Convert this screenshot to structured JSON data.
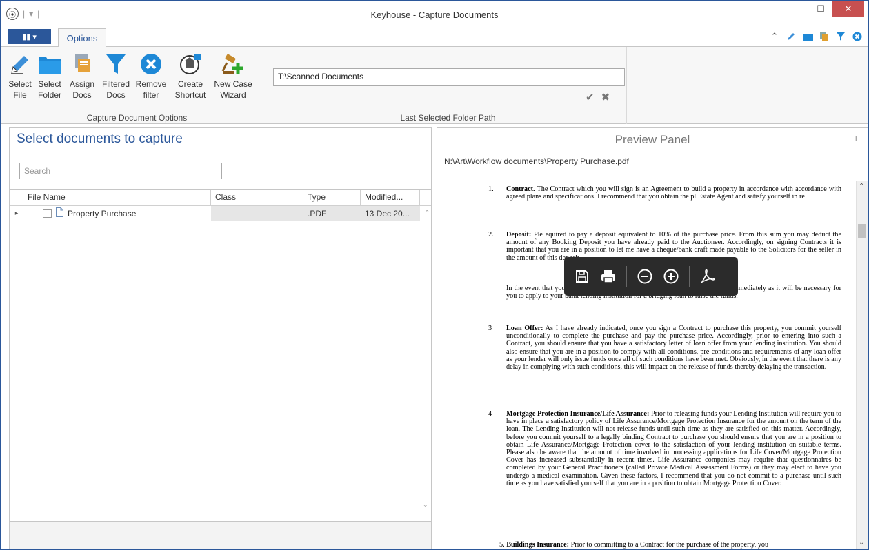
{
  "window": {
    "title": "Keyhouse - Capture Documents"
  },
  "tabs": {
    "file_label": "▮▮ ▾",
    "options_label": "Options"
  },
  "ribbon": {
    "capture_group_label": "Capture Document Options",
    "buttons": [
      {
        "line1": "Select",
        "line2": "File",
        "icon": "pencil-icon"
      },
      {
        "line1": "Select",
        "line2": "Folder",
        "icon": "folder-icon"
      },
      {
        "line1": "Assign",
        "line2": "Docs",
        "icon": "assign-docs-icon"
      },
      {
        "line1": "Filtered",
        "line2": "Docs",
        "icon": "filter-icon"
      },
      {
        "line1": "Remove",
        "line2": "filter",
        "icon": "remove-filter-icon"
      },
      {
        "line1": "Create",
        "line2": "Shortcut",
        "icon": "shortcut-icon"
      },
      {
        "line1": "New Case",
        "line2": "Wizard",
        "icon": "wizard-icon"
      }
    ],
    "folder_group_label": "Last Selected Folder Path",
    "folder_path": "T:\\Scanned Documents"
  },
  "left_panel": {
    "title": "Select documents to capture",
    "search_placeholder": "Search",
    "columns": [
      "File Name",
      "Class",
      "Type",
      "Modified..."
    ],
    "rows": [
      {
        "name": "Property Purchase",
        "class": "",
        "type": ".PDF",
        "modified": "13 Dec 20..."
      }
    ]
  },
  "right_panel": {
    "title": "Preview Panel",
    "file_path": "N:\\Art\\Workflow documents\\Property Purchase.pdf",
    "toolbar_icons": [
      "save-icon",
      "print-icon",
      "zoom-out-icon",
      "zoom-in-icon",
      "acrobat-icon"
    ]
  },
  "document": {
    "p1_num": "1.",
    "p1_head": "Contract.",
    "p1_text": "The Contract which you will sign is an Agreement to build a property in accordance with accordance with agreed plans and specifications.   I recommend that you obtain the pl",
    "p1_text2": "Estate Agent and satisfy",
    "p1_text3": "yourself in re",
    "p2_num": "2.",
    "p2_head": "Deposit:",
    "p2_text_a": "Ple",
    "p2_text_b": "equired to pay a deposit",
    "p2_text": "equivalent to 10% of the purchase price.  From this sum you may deduct the amount of any Booking Deposit you have already paid to the Auctioneer.  Accordingly, on signing Contracts it is important that you are in a position to let me have a cheque/bank draft made payable to the Solicitors for the seller in the amount of this deposit.",
    "p2b_text": "In the event that you are not in a position to pay this deposit please advise me immediately as it will be necessary for you to apply to your bank/lending institution for a bridging loan to raise the funds.",
    "p3_num": "3",
    "p3_head": "Loan Offer:",
    "p3_text": "As I have already indicated, once you sign a Contract to purchase this property, you commit yourself unconditionally to complete the purchase and pay the purchase price. Accordingly, prior to entering into such a Contract, you should ensure that you have a satisfactory letter of loan offer from your lending institution.  You should also ensure that you are in a position to comply with all conditions, pre-conditions and requirements of any loan offer as your lender will only issue funds once all of such conditions have been met. Obviously, in the event that there is any delay in complying with such conditions, this will impact on the release of funds thereby delaying the transaction.",
    "p4_num": "4",
    "p4_head": "Mortgage Protection Insurance/Life Assurance:",
    "p4_text": "Prior to releasing funds your Lending Institution will require you to have in place a satisfactory policy of Life Assurance/Mortgage Protection Insurance for the amount on the term of the loan.  The Lending Institution will not release funds until such time as they are satisfied on this matter.  Accordingly, before you commit yourself to a legally binding Contract to purchase you should ensure that you are in a position to obtain Life Assurance/Mortgage Protection cover to the satisfaction of your lending institution on suitable terms.  Please also be aware that the amount of time involved in processing applications for Life Cover/Mortgage Protection Cover has increased substantially in recent times.  Life Assurance companies may require that questionnaires be completed by your General Practitioners (called Private Medical Assessment Forms) or they may elect to have you undergo a medical examination.  Given these factors, I recommend that you do not commit to a purchase until such time as you have satisfied yourself that you are in a position to obtain Mortgage Protection Cover.",
    "p5_num": "5.",
    "p5_head": "Buildings Insurance:",
    "p5_text": "Prior to committing to a Contract for the purchase of the property, you"
  }
}
